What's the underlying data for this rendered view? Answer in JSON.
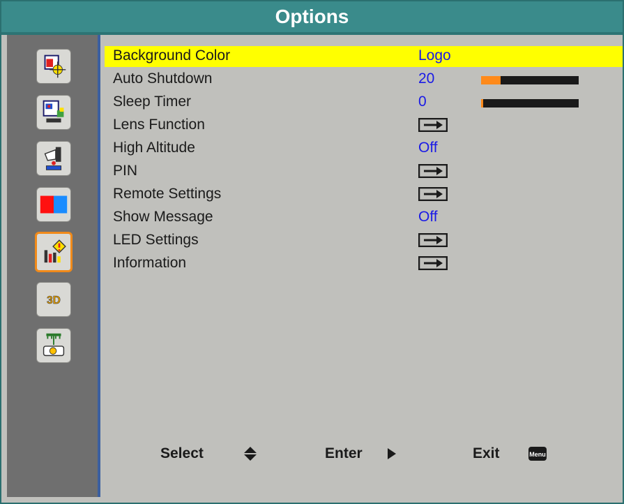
{
  "window": {
    "title": "Options"
  },
  "menu": {
    "items": [
      {
        "label": "Background Color",
        "value": "Logo",
        "type": "value",
        "selected": true
      },
      {
        "label": "Auto Shutdown",
        "value": "20",
        "type": "slider",
        "level_percent": 20
      },
      {
        "label": "Sleep Timer",
        "value": "0",
        "type": "slider",
        "level_percent": 0
      },
      {
        "label": "Lens Function",
        "type": "submenu"
      },
      {
        "label": "High Altitude",
        "value": "Off",
        "type": "value"
      },
      {
        "label": "PIN",
        "type": "submenu"
      },
      {
        "label": "Remote Settings",
        "type": "submenu"
      },
      {
        "label": "Show Message",
        "value": "Off",
        "type": "value"
      },
      {
        "label": "LED Settings",
        "type": "submenu"
      },
      {
        "label": "Information",
        "type": "submenu"
      }
    ]
  },
  "sidebar": {
    "icons": [
      {
        "name": "image-settings-icon",
        "active": false
      },
      {
        "name": "display-settings-icon",
        "active": false
      },
      {
        "name": "setup-icon",
        "active": false
      },
      {
        "name": "color-icon",
        "active": false
      },
      {
        "name": "options-icon",
        "active": true
      },
      {
        "name": "3d-icon",
        "active": false,
        "text": "3D"
      },
      {
        "name": "network-icon",
        "active": false
      }
    ]
  },
  "footer": {
    "select_label": "Select",
    "enter_label": "Enter",
    "exit_label": "Exit",
    "menu_badge": "Menu"
  },
  "colors": {
    "title_bg": "#3a8b8b",
    "selected_row": "#ffff00",
    "value_text": "#1a1ae6",
    "slider_fill": "#ff8a1a",
    "active_icon_border": "#f08a1a"
  }
}
